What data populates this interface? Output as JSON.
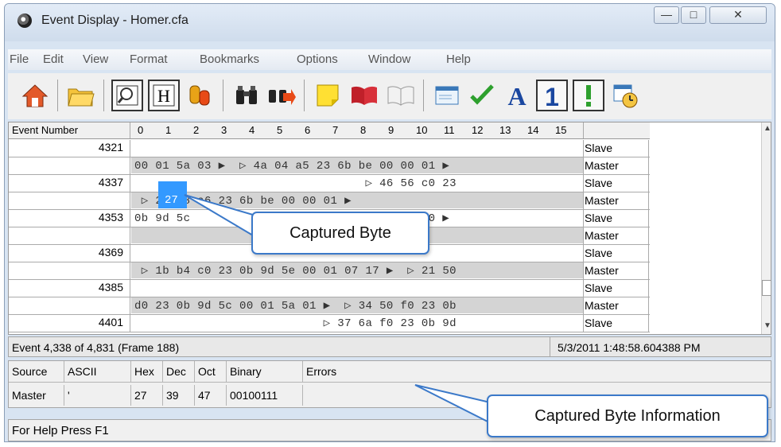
{
  "window": {
    "title": "Event Display - Homer.cfa"
  },
  "menu": [
    "File",
    "Edit",
    "View",
    "Format",
    "Bookmarks",
    "Options",
    "Window",
    "Help"
  ],
  "toolbar_icons": [
    "home-icon",
    "open-folder-icon",
    "magnifier-icon",
    "h-icon",
    "wire-spool-icon",
    "binoculars-icon",
    "binoculars-next-icon",
    "sticky-note-icon",
    "bookmark-book-icon",
    "empty-book-icon",
    "window-icon",
    "checkmark-icon",
    "font-a-icon",
    "number-one-icon",
    "exclamation-icon",
    "calendar-clock-icon"
  ],
  "table": {
    "event_header": "Event Number",
    "col_headers": [
      "0",
      "1",
      "2",
      "3",
      "4",
      "5",
      "6",
      "7",
      "8",
      "9",
      "10",
      "11",
      "12",
      "13",
      "14",
      "15"
    ],
    "rows": [
      {
        "num": "4321",
        "hex": "",
        "role": "Slave",
        "gray": false
      },
      {
        "num": "",
        "hex": "00 01 5a 03 ▶  ▷ 4a 04 a5 23 6b be 00 00 01 ▶",
        "role": "Master",
        "gray": true
      },
      {
        "num": "4337",
        "hex": "                                 ▷ 46 56 c0 23",
        "role": "Slave",
        "gray": false
      },
      {
        "num": "",
        "hex": " ▷ 27 78 a6 23 6b be 00 00 01 ▶",
        "role": "Master",
        "gray": true
      },
      {
        "num": "4353",
        "hex": "0b 9d 5c                      3 08 00 08 00 ▶",
        "role": "Slave",
        "gray": false
      },
      {
        "num": "",
        "hex": "",
        "role": "Master",
        "gray": true
      },
      {
        "num": "4369",
        "hex": "",
        "role": "Slave",
        "gray": false
      },
      {
        "num": "",
        "hex": " ▷ 1b b4 c0 23 0b 9d 5e 00 01 07 17 ▶  ▷ 21 50",
        "role": "Master",
        "gray": true
      },
      {
        "num": "4385",
        "hex": "",
        "role": "Slave",
        "gray": false
      },
      {
        "num": "",
        "hex": "d0 23 0b 9d 5c 00 01 5a 01 ▶  ▷ 34 50 f0 23 0b",
        "role": "Master",
        "gray": true
      },
      {
        "num": "4401",
        "hex": "                           ▷ 37 6a f0 23 0b 9d",
        "role": "Slave",
        "gray": false
      }
    ],
    "highlight_byte": "27"
  },
  "info": {
    "event": "Event 4,338 of 4,831 (Frame 188)",
    "timestamp": "5/3/2011 1:48:58.604388 PM"
  },
  "detail": {
    "headers": [
      "Source",
      "ASCII",
      "Hex",
      "Dec",
      "Oct",
      "Binary",
      "Errors"
    ],
    "values": [
      "Master",
      "'",
      "27",
      "39",
      "47",
      "00100111",
      ""
    ]
  },
  "status": {
    "text": "For Help Press F1"
  },
  "callouts": {
    "byte": "Captured Byte",
    "info": "Captured Byte Information"
  },
  "colors": {
    "highlight": "#3399ff",
    "callout_border": "#3b79c9"
  }
}
